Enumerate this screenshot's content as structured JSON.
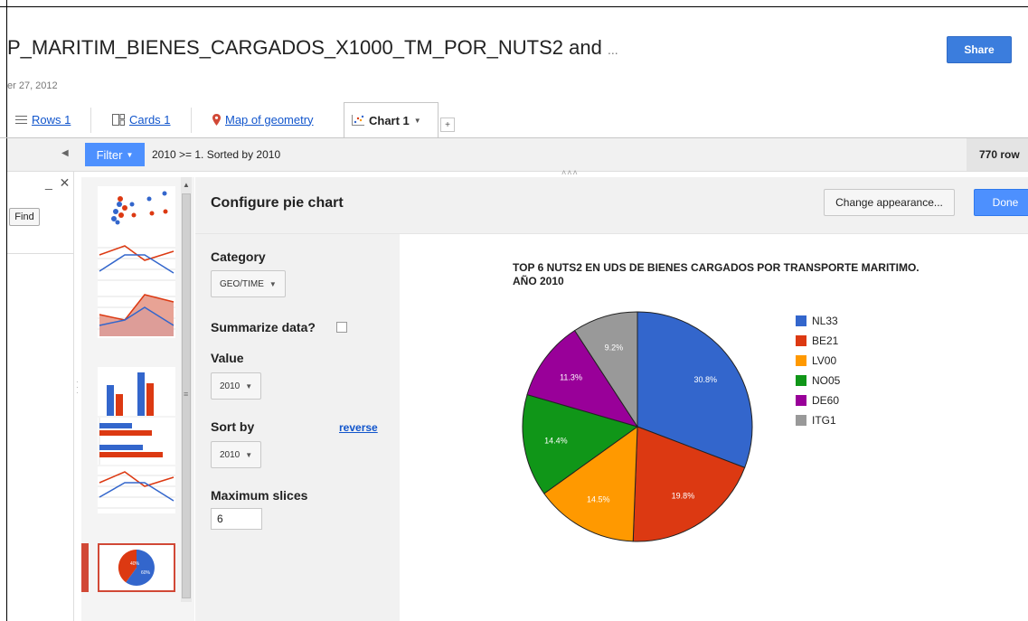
{
  "doc": {
    "title": "P_MARITIM_BIENES_CARGADOS_X1000_TM_POR_NUTS2 and",
    "title_ellipsis": "...",
    "date": "er 27, 2012",
    "share_label": "Share"
  },
  "tabs": [
    {
      "label": "Rows 1",
      "icon": "rows-icon"
    },
    {
      "label": "Cards 1",
      "icon": "cards-icon"
    },
    {
      "label": "Map of geometry",
      "icon": "map-pin-icon"
    },
    {
      "label": "Chart 1",
      "icon": "chart-icon",
      "active": true
    }
  ],
  "add_tab_label": "+",
  "filterbar": {
    "filter_label": "Filter",
    "filter_text": "2010 >= 1. Sorted by 2010",
    "rows_count": "770 row"
  },
  "left_panel": {
    "close_label": "_ ✕",
    "find_label": "Find"
  },
  "config": {
    "title": "Configure pie chart",
    "appearance_label": "Change appearance...",
    "done_label": "Done",
    "category_label": "Category",
    "category_value": "GEO/TIME",
    "summarize_label": "Summarize data?",
    "value_label": "Value",
    "value_value": "2010",
    "sortby_label": "Sort by",
    "sortby_value": "2010",
    "reverse_label": "reverse",
    "maxslices_label": "Maximum slices",
    "maxslices_value": "6"
  },
  "thumb_pie_labels": [
    "40%",
    "60%"
  ],
  "chart_data": {
    "type": "pie",
    "title": "TOP 6 NUTS2 EN UDS DE BIENES CARGADOS POR TRANSPORTE MARITIMO. AÑO 2010",
    "categories": [
      "NL33",
      "BE21",
      "LV00",
      "NO05",
      "DE60",
      "ITG1"
    ],
    "values": [
      30.8,
      19.8,
      14.5,
      14.4,
      11.3,
      9.2
    ],
    "labels": [
      "30.8%",
      "19.8%",
      "14.5%",
      "14.4%",
      "11.3%",
      "9.2%"
    ],
    "colors": [
      "#3366cc",
      "#dc3912",
      "#ff9900",
      "#109618",
      "#990099",
      "#999999"
    ],
    "legend_position": "right"
  }
}
